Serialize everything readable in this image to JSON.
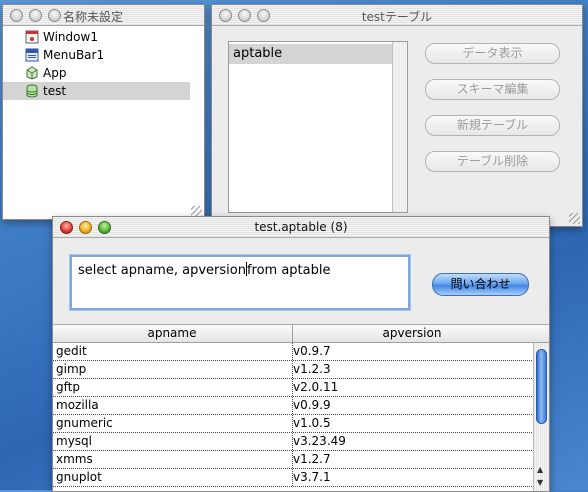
{
  "project_window": {
    "title": "名称未設定",
    "items": [
      {
        "label": "Window1",
        "icon": "window-icon"
      },
      {
        "label": "MenuBar1",
        "icon": "menubar-icon"
      },
      {
        "label": "App",
        "icon": "app-icon"
      },
      {
        "label": "test",
        "icon": "database-icon",
        "selected": true
      }
    ]
  },
  "tables_window": {
    "title": "testテーブル",
    "tables": [
      "aptable"
    ],
    "buttons": {
      "view_data": "データ表示",
      "edit_schema": "スキーマ編集",
      "new_table": "新規テーブル",
      "delete_table": "テーブル削除"
    }
  },
  "query_window": {
    "title": "test.aptable (8)",
    "query_text_before_caret": "select apname, apversion",
    "query_text_after_caret": "from aptable",
    "query_button": "問い合わせ",
    "columns": [
      "apname",
      "apversion"
    ],
    "rows": [
      [
        "gedit",
        "v0.9.7"
      ],
      [
        "gimp",
        "v1.2.3"
      ],
      [
        "gftp",
        "v2.0.11"
      ],
      [
        "mozilla",
        "v0.9.9"
      ],
      [
        "gnumeric",
        "v1.0.5"
      ],
      [
        "mysql",
        "v3.23.49"
      ],
      [
        "xmms",
        "v1.2.7"
      ],
      [
        "gnuplot",
        "v3.7.1"
      ]
    ]
  },
  "colors": {
    "desktop": "#3f7cc6",
    "selection": "#d4d4d4",
    "aqua_button": "#3e86e6"
  }
}
